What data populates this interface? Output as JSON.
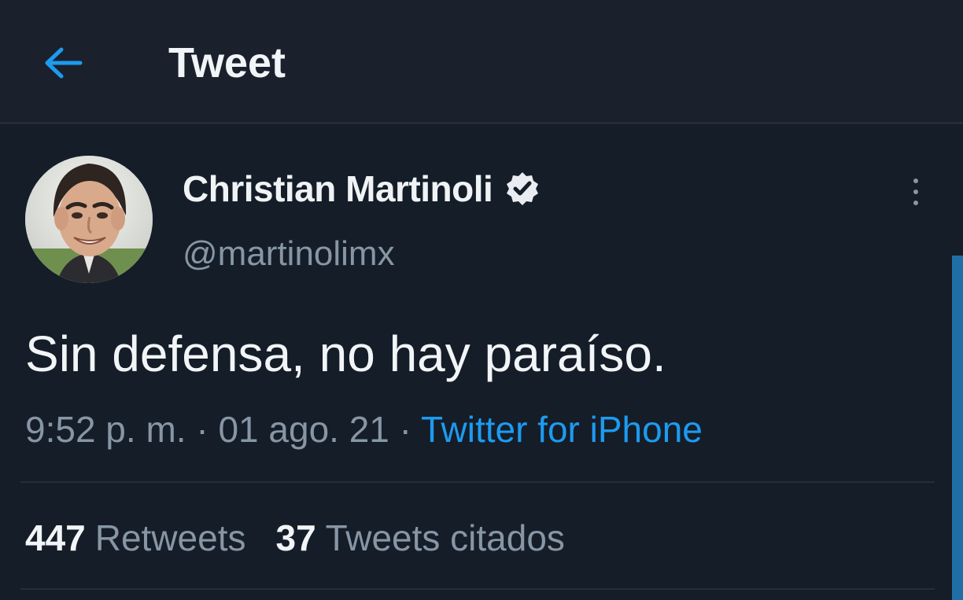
{
  "header": {
    "back_icon": "arrow-left-icon",
    "title": "Tweet"
  },
  "tweet": {
    "author": {
      "name": "Christian Martinoli",
      "handle": "@martinolimx",
      "verified": true,
      "verified_icon": "verified-badge-icon",
      "avatar": "avatar-photo"
    },
    "more_icon": "more-vertical-icon",
    "text": "Sin defensa, no hay paraíso.",
    "time": "9:52 p. m.",
    "separator": " · ",
    "date": "01 ago. 21",
    "source": "Twitter for iPhone"
  },
  "stats": {
    "retweets": {
      "count": "447",
      "label": "Retweets"
    },
    "quotes": {
      "count": "37",
      "label": "Tweets citados"
    }
  },
  "colors": {
    "background": "#151d28",
    "accent": "#1d9bf0",
    "secondary_text": "#8796a5",
    "primary_text": "#f2f5f7",
    "scrollbar": "#1f6fa6"
  }
}
